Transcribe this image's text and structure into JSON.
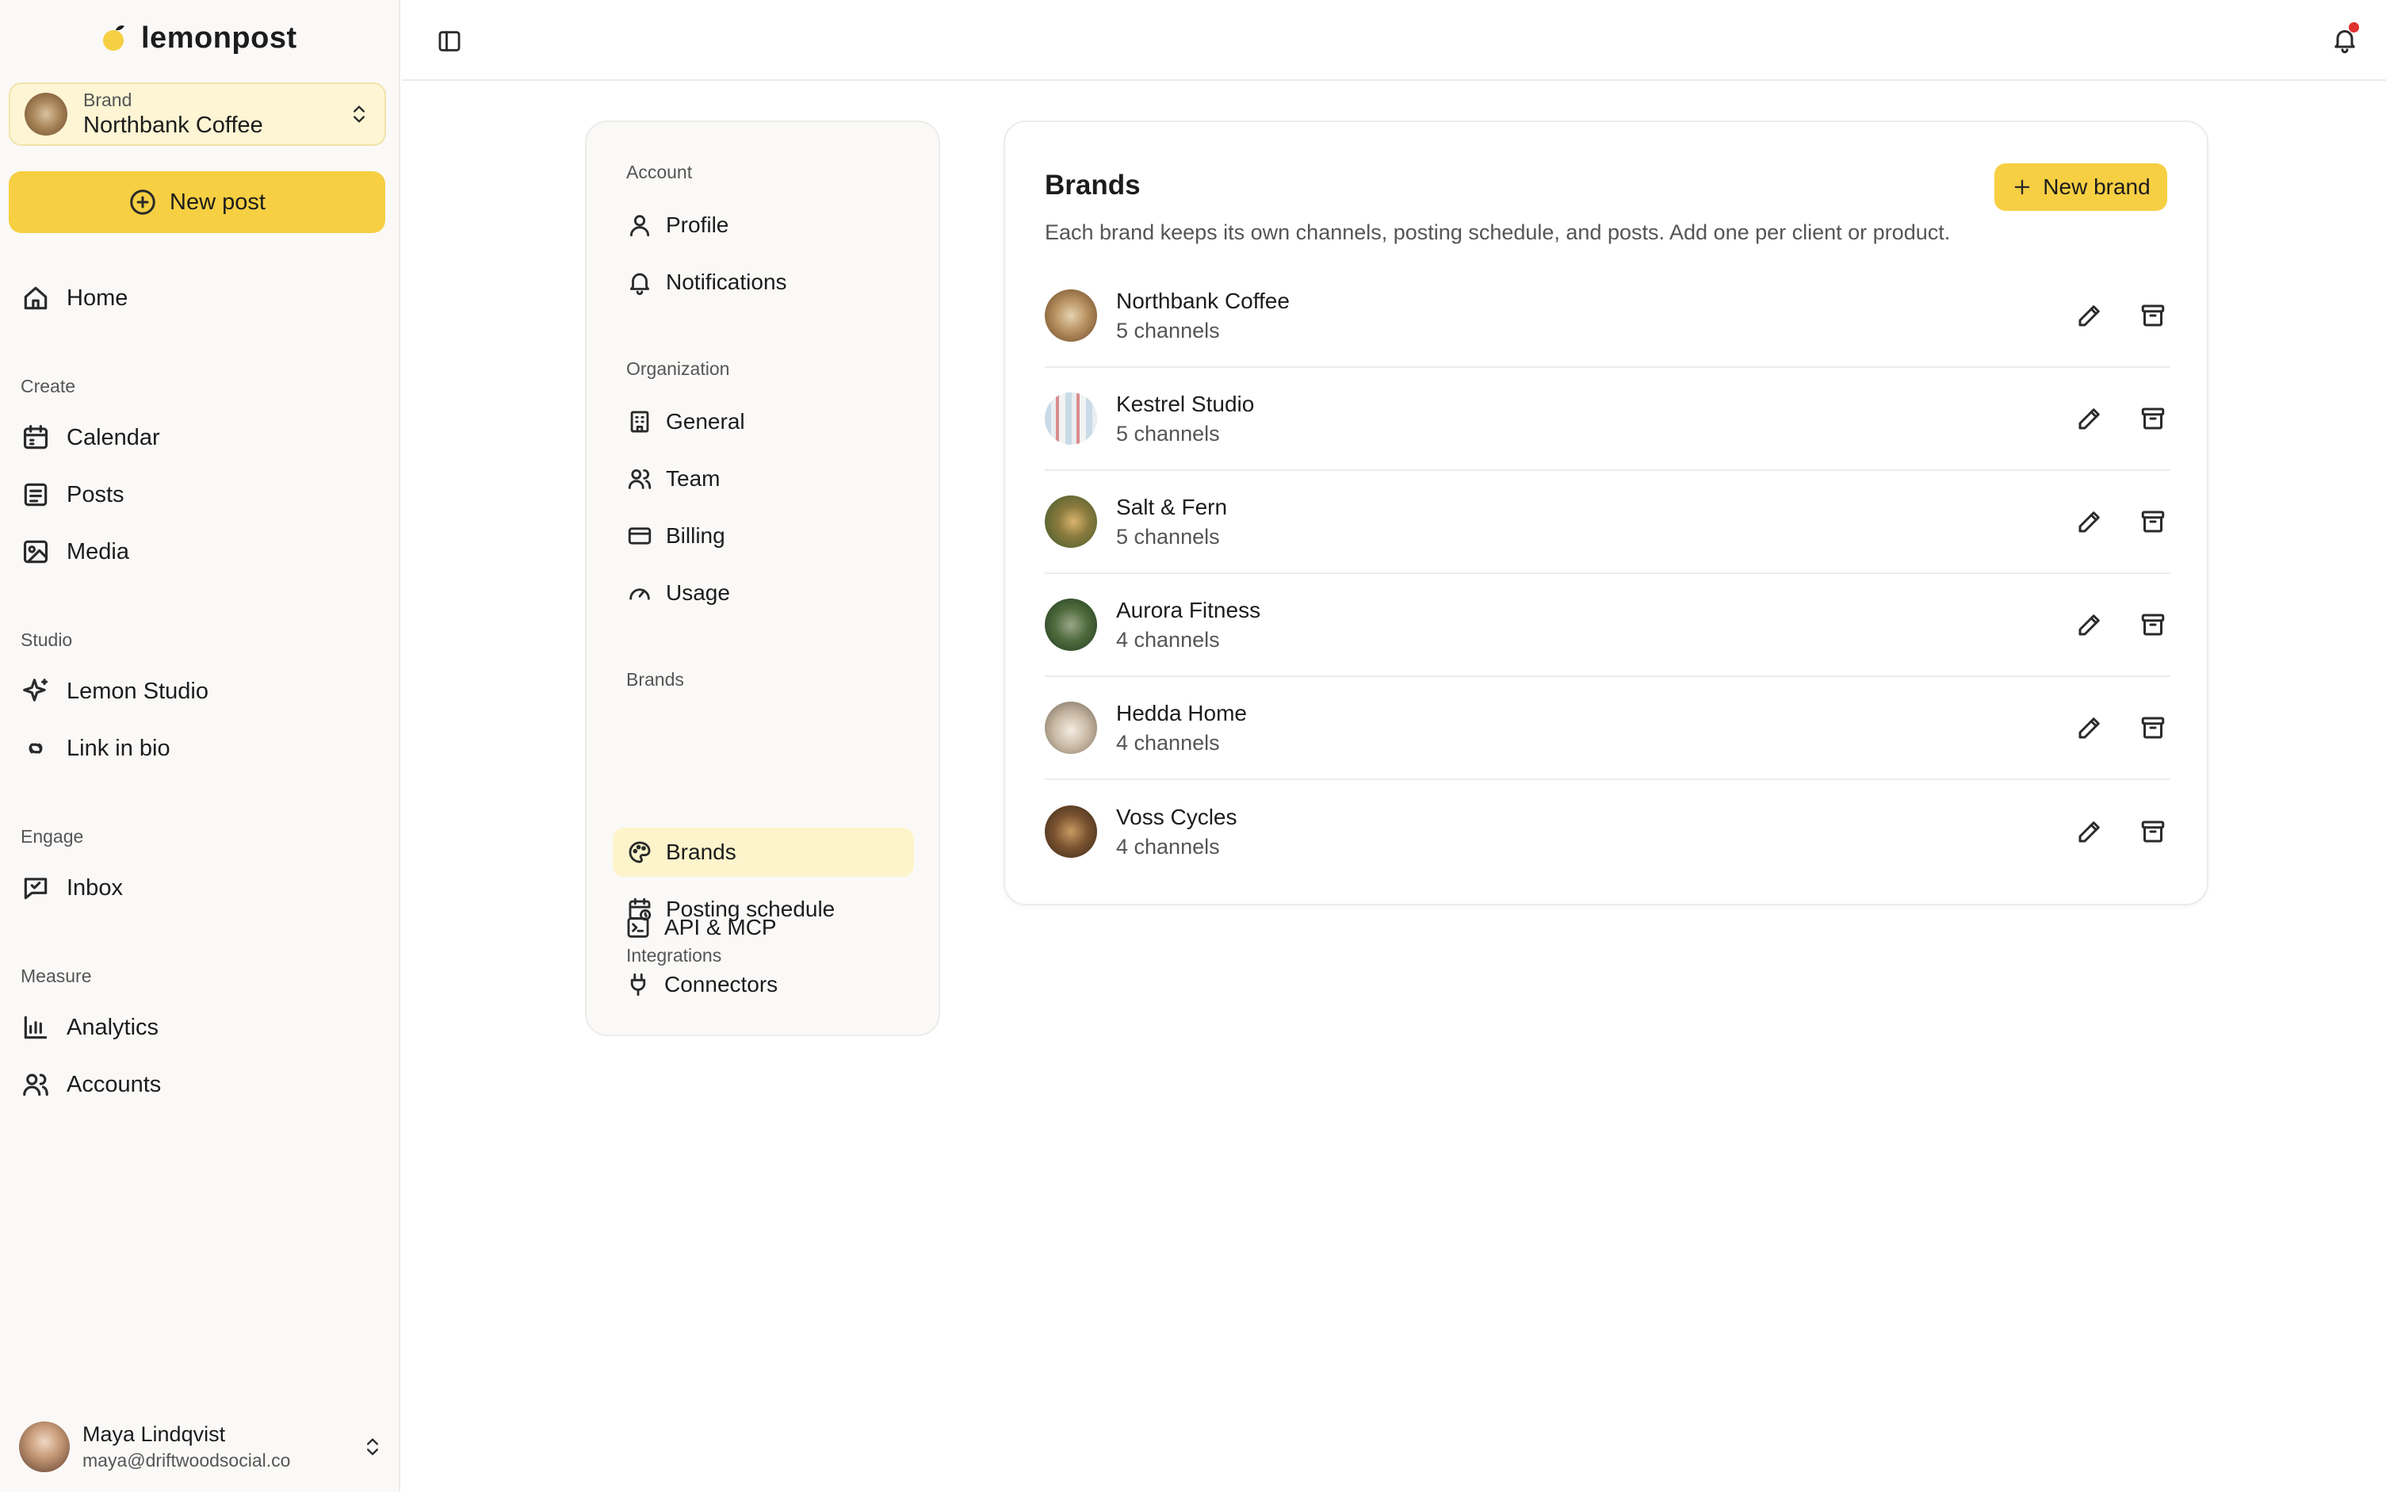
{
  "app": {
    "name": "lemonpost"
  },
  "brand_switcher": {
    "label": "Brand",
    "value": "Northbank Coffee"
  },
  "new_post": {
    "label": "New post"
  },
  "sidebar": {
    "home": "Home",
    "groups": {
      "create": "Create",
      "studio": "Studio",
      "engage": "Engage",
      "measure": "Measure"
    },
    "items": {
      "calendar": "Calendar",
      "posts": "Posts",
      "media": "Media",
      "lemon_studio": "Lemon Studio",
      "link_in_bio": "Link in bio",
      "inbox": "Inbox",
      "analytics": "Analytics",
      "accounts": "Accounts"
    }
  },
  "user": {
    "name": "Maya Lindqvist",
    "email": "maya@driftwoodsocial.co"
  },
  "settings_nav": {
    "groups": {
      "account": "Account",
      "organization": "Organization",
      "brands": "Brands",
      "integrations": "Integrations"
    },
    "items": {
      "profile": "Profile",
      "notifications": "Notifications",
      "general": "General",
      "team": "Team",
      "billing": "Billing",
      "usage": "Usage",
      "brands": "Brands",
      "posting_schedule": "Posting schedule",
      "api_mcp": "API & MCP",
      "connectors": "Connectors"
    },
    "active": "brands"
  },
  "brands_panel": {
    "title": "Brands",
    "subtitle": "Each brand keeps its own channels, posting schedule, and posts. Add one per client or product.",
    "new_brand_label": "New brand",
    "brands": [
      {
        "name": "Northbank Coffee",
        "channels": "5 channels"
      },
      {
        "name": "Kestrel Studio",
        "channels": "5 channels"
      },
      {
        "name": "Salt & Fern",
        "channels": "5 channels"
      },
      {
        "name": "Aurora Fitness",
        "channels": "4 channels"
      },
      {
        "name": "Hedda Home",
        "channels": "4 channels"
      },
      {
        "name": "Voss Cycles",
        "channels": "4 channels"
      }
    ]
  },
  "colors": {
    "accent": "#f6cf43",
    "active_bg": "#fdf4cc",
    "sidebar_bg": "#faf9f7",
    "notification_dot": "#e0322f"
  },
  "icons": {
    "logo": "lemon-icon",
    "new_post": "plus-circle-icon",
    "new_brand": "plus-icon",
    "row_actions": [
      "pencil-icon",
      "archive-icon"
    ],
    "bell": "bell-icon",
    "sidebar_toggle": "panel-left-icon"
  }
}
